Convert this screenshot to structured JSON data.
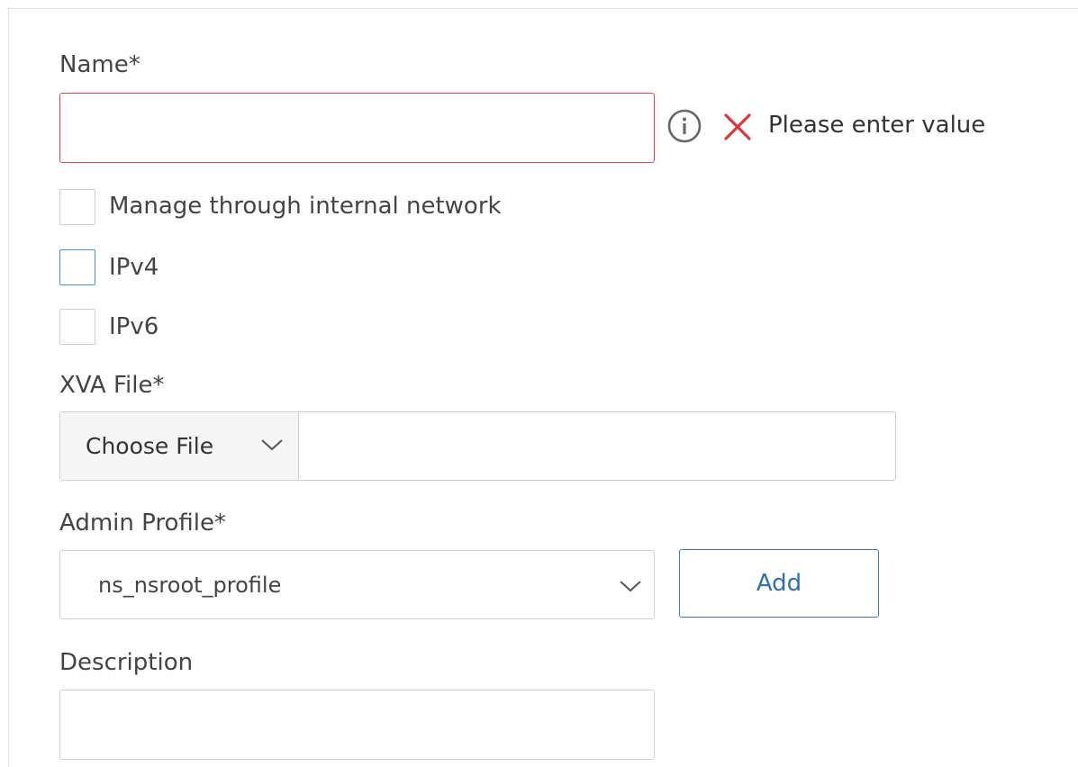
{
  "form": {
    "name": {
      "label": "Name*",
      "value": "",
      "placeholder": "",
      "error_message": "Please enter value"
    },
    "checkboxes": [
      {
        "label": "Manage through internal network",
        "checked": false
      },
      {
        "label": "IPv4",
        "checked": false
      },
      {
        "label": "IPv6",
        "checked": false
      }
    ],
    "xva_file": {
      "label": "XVA File*",
      "button_label": "Choose File",
      "value": ""
    },
    "admin_profile": {
      "label": "Admin Profile*",
      "selected": "ns_nsroot_profile",
      "add_label": "Add"
    },
    "description": {
      "label": "Description",
      "value": ""
    }
  },
  "colors": {
    "error_border": "#e0464a",
    "error_icon": "#e0353b",
    "focus_border": "#4e93d1",
    "primary_button": "#2f6fae"
  },
  "icons": {
    "info": "info-icon",
    "error": "close-icon",
    "dropdown": "chevron-down-icon"
  }
}
